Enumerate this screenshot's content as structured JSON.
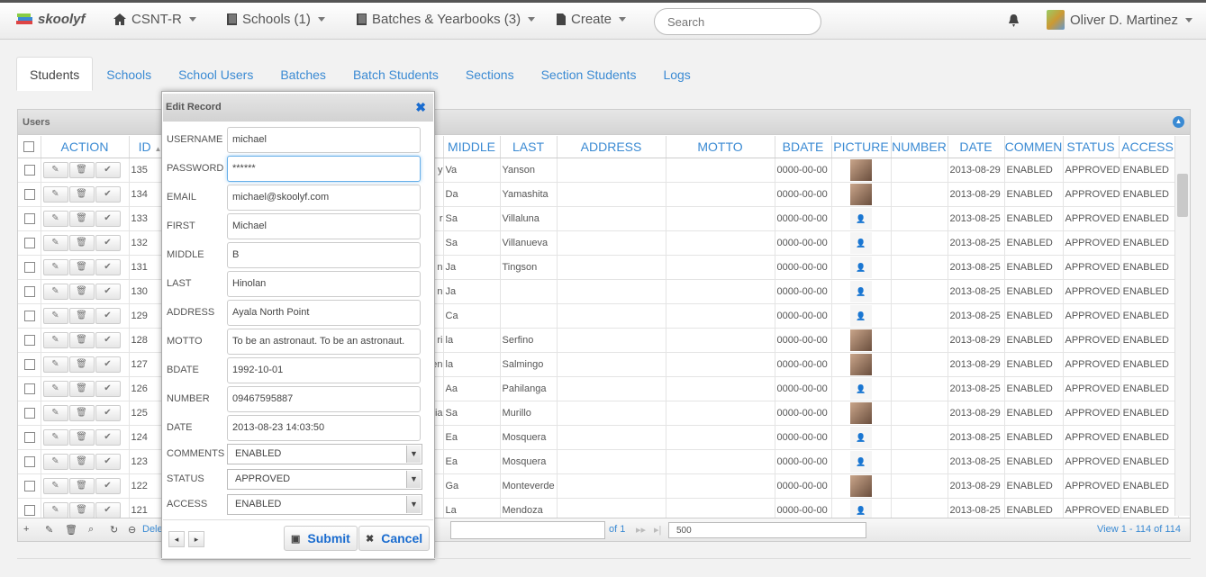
{
  "navbar": {
    "brand": "skoolyf",
    "school": "CSNT-R",
    "schools": "Schools (1)",
    "batches": "Batches & Yearbooks (3)",
    "create": "Create",
    "search_placeholder": "Search",
    "user": "Oliver D. Martinez"
  },
  "tabs": [
    "Students",
    "Schools",
    "School Users",
    "Batches",
    "Batch Students",
    "Sections",
    "Section Students",
    "Logs"
  ],
  "panel": {
    "title": "Users"
  },
  "columns": [
    "ACTION",
    "ID",
    "MIDDLE",
    "LAST",
    "ADDRESS",
    "MOTTO",
    "BDATE",
    "PICTURE",
    "NUMBER",
    "DATE",
    "COMMEN",
    "STATUS",
    "ACCESS"
  ],
  "rows": [
    {
      "id": "135",
      "hidden_frag": "y",
      "middle": "Va",
      "last": "Yanson",
      "bdate": "0000-00-00",
      "pic": "photo",
      "date": "2013-08-29",
      "comments": "ENABLED",
      "status": "APPROVED",
      "access": "ENABLED"
    },
    {
      "id": "134",
      "hidden_frag": "",
      "middle": "Da",
      "last": "Yamashita",
      "bdate": "0000-00-00",
      "pic": "photo",
      "date": "2013-08-29",
      "comments": "ENABLED",
      "status": "APPROVED",
      "access": "ENABLED"
    },
    {
      "id": "133",
      "hidden_frag": "r",
      "middle": "Sa",
      "last": "Villaluna",
      "bdate": "0000-00-00",
      "pic": "empty",
      "date": "2013-08-25",
      "comments": "ENABLED",
      "status": "APPROVED",
      "access": "ENABLED"
    },
    {
      "id": "132",
      "hidden_frag": "",
      "middle": "Sa",
      "last": "Villanueva",
      "bdate": "0000-00-00",
      "pic": "empty",
      "date": "2013-08-25",
      "comments": "ENABLED",
      "status": "APPROVED",
      "access": "ENABLED"
    },
    {
      "id": "131",
      "hidden_frag": "n",
      "middle": "Ja",
      "last": "Tingson",
      "bdate": "0000-00-00",
      "pic": "empty",
      "date": "2013-08-25",
      "comments": "ENABLED",
      "status": "APPROVED",
      "access": "ENABLED"
    },
    {
      "id": "130",
      "hidden_frag": "n",
      "middle": "Ja",
      "last": "",
      "bdate": "0000-00-00",
      "pic": "empty",
      "date": "2013-08-25",
      "comments": "ENABLED",
      "status": "APPROVED",
      "access": "ENABLED"
    },
    {
      "id": "129",
      "hidden_frag": "",
      "middle": "Ca",
      "last": "",
      "bdate": "0000-00-00",
      "pic": "empty",
      "date": "2013-08-25",
      "comments": "ENABLED",
      "status": "APPROVED",
      "access": "ENABLED"
    },
    {
      "id": "128",
      "hidden_frag": "ri",
      "middle": "la",
      "last": "Serfino",
      "bdate": "0000-00-00",
      "pic": "photo",
      "date": "2013-08-29",
      "comments": "ENABLED",
      "status": "APPROVED",
      "access": "ENABLED"
    },
    {
      "id": "127",
      "hidden_frag": "en",
      "middle": "la",
      "last": "Salmingo",
      "bdate": "0000-00-00",
      "pic": "photo",
      "date": "2013-08-29",
      "comments": "ENABLED",
      "status": "APPROVED",
      "access": "ENABLED"
    },
    {
      "id": "126",
      "hidden_frag": "",
      "middle": "Aa",
      "last": "Pahilanga",
      "bdate": "0000-00-00",
      "pic": "empty",
      "date": "2013-08-25",
      "comments": "ENABLED",
      "status": "APPROVED",
      "access": "ENABLED"
    },
    {
      "id": "125",
      "hidden_frag": "sia",
      "middle": "Sa",
      "last": "Murillo",
      "bdate": "0000-00-00",
      "pic": "photo",
      "date": "2013-08-29",
      "comments": "ENABLED",
      "status": "APPROVED",
      "access": "ENABLED"
    },
    {
      "id": "124",
      "hidden_frag": "",
      "middle": "Ea",
      "last": "Mosquera",
      "bdate": "0000-00-00",
      "pic": "empty",
      "date": "2013-08-25",
      "comments": "ENABLED",
      "status": "APPROVED",
      "access": "ENABLED"
    },
    {
      "id": "123",
      "hidden_frag": "",
      "middle": "Ea",
      "last": "Mosquera",
      "bdate": "0000-00-00",
      "pic": "empty",
      "date": "2013-08-25",
      "comments": "ENABLED",
      "status": "APPROVED",
      "access": "ENABLED"
    },
    {
      "id": "122",
      "hidden_frag": "",
      "middle": "Ga",
      "last": "Monteverde",
      "bdate": "0000-00-00",
      "pic": "photo",
      "date": "2013-08-29",
      "comments": "ENABLED",
      "status": "APPROVED",
      "access": "ENABLED"
    },
    {
      "id": "121",
      "hidden_frag": "",
      "middle": "La",
      "last": "Mendoza",
      "bdate": "0000-00-00",
      "pic": "empty",
      "date": "2013-08-25",
      "comments": "ENABLED",
      "status": "APPROVED",
      "access": "ENABLED"
    }
  ],
  "pager": {
    "delete": "Dele",
    "of": "of 1",
    "rows": "500",
    "view": "View 1 - 114 of 114"
  },
  "dialog": {
    "title": "Edit Record",
    "fields": [
      {
        "label": "USERNAME",
        "value": "michael"
      },
      {
        "label": "PASSWORD",
        "value": "******"
      },
      {
        "label": "EMAIL",
        "value": "michael@skoolyf.com"
      },
      {
        "label": "FIRST",
        "value": "Michael"
      },
      {
        "label": "MIDDLE",
        "value": "B"
      },
      {
        "label": "LAST",
        "value": "Hinolan"
      },
      {
        "label": "ADDRESS",
        "value": "Ayala North Point"
      },
      {
        "label": "MOTTO",
        "value": "To be an astronaut. To be an astronaut."
      },
      {
        "label": "BDATE",
        "value": "1992-10-01"
      },
      {
        "label": "NUMBER",
        "value": "09467595887"
      },
      {
        "label": "DATE",
        "value": "2013-08-23 14:03:50"
      }
    ],
    "selects": [
      {
        "label": "COMMENTS",
        "value": "ENABLED"
      },
      {
        "label": "STATUS",
        "value": "APPROVED"
      },
      {
        "label": "ACCESS",
        "value": "ENABLED"
      }
    ],
    "submit": "Submit",
    "cancel": "Cancel"
  },
  "colors": {
    "link": "#3a8ad3",
    "accent": "#1a6ccf"
  }
}
